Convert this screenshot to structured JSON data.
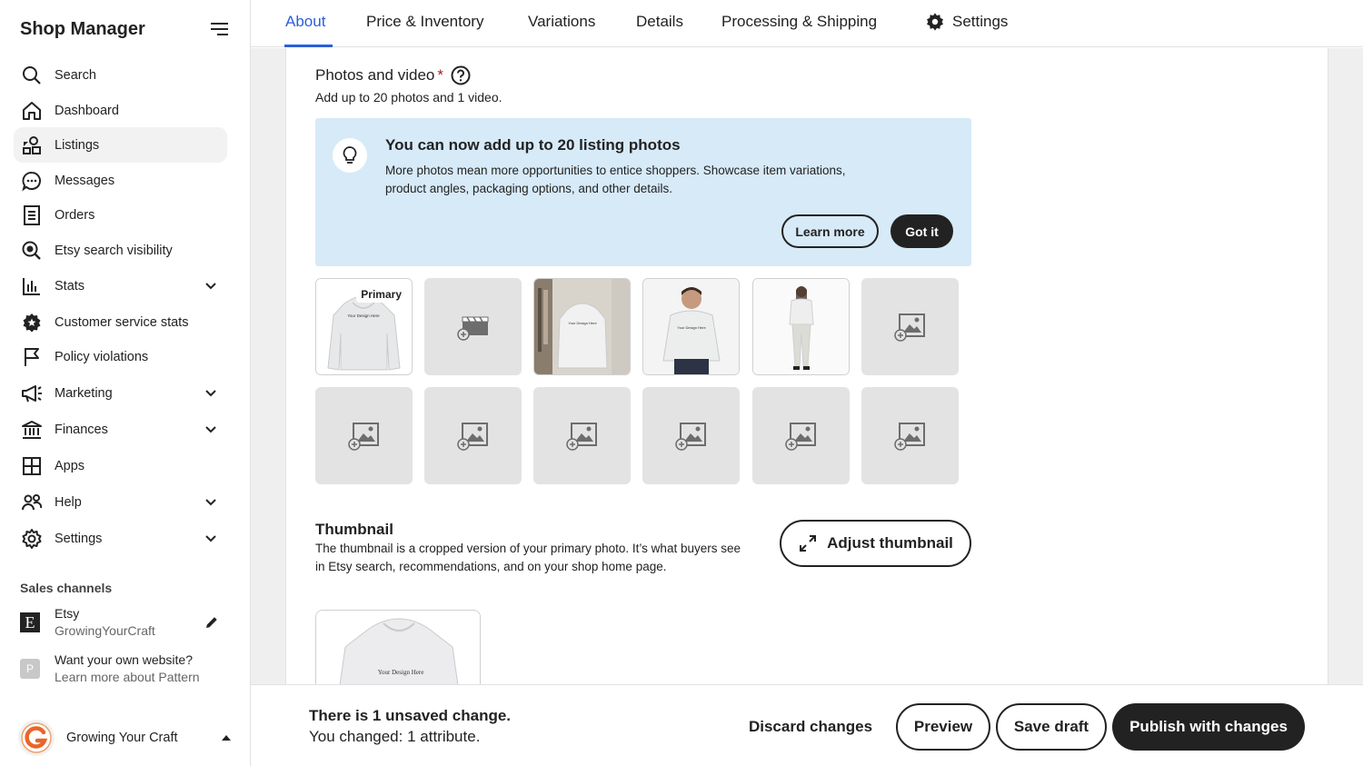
{
  "sidebar": {
    "title": "Shop Manager",
    "items": [
      {
        "label": "Search",
        "icon": "search-icon"
      },
      {
        "label": "Dashboard",
        "icon": "home-icon"
      },
      {
        "label": "Listings",
        "icon": "listings-icon",
        "active": true
      },
      {
        "label": "Messages",
        "icon": "messages-icon"
      },
      {
        "label": "Orders",
        "icon": "orders-icon"
      },
      {
        "label": "Etsy search visibility",
        "icon": "search-visibility-icon"
      },
      {
        "label": "Stats",
        "icon": "stats-icon",
        "expandable": true
      },
      {
        "label": "Customer service stats",
        "icon": "badge-icon"
      },
      {
        "label": "Policy violations",
        "icon": "flag-icon"
      },
      {
        "label": "Marketing",
        "icon": "megaphone-icon",
        "expandable": true
      },
      {
        "label": "Finances",
        "icon": "bank-icon",
        "expandable": true
      },
      {
        "label": "Apps",
        "icon": "apps-icon"
      },
      {
        "label": "Help",
        "icon": "people-icon",
        "expandable": true
      },
      {
        "label": "Settings",
        "icon": "gear-icon",
        "expandable": true
      }
    ],
    "sales_channels_title": "Sales channels",
    "channel": {
      "badge": "E",
      "name": "Etsy",
      "shop": "GrowingYourCraft"
    },
    "pattern": {
      "badge": "P",
      "title": "Want your own website?",
      "sub": "Learn more about Pattern"
    },
    "shop_user": {
      "name": "Growing Your Craft"
    }
  },
  "tabs": [
    {
      "label": "About",
      "active": true
    },
    {
      "label": "Price & Inventory"
    },
    {
      "label": "Variations"
    },
    {
      "label": "Details"
    },
    {
      "label": "Processing & Shipping"
    },
    {
      "label": "Settings",
      "icon": "gear-icon"
    }
  ],
  "photos": {
    "title": "Photos and video",
    "required_mark": "*",
    "subtitle": "Add up to 20 photos and 1 video.",
    "primary_tag": "Primary",
    "design_text": "Your Design Here"
  },
  "banner": {
    "title": "You can now add up to 20 listing photos",
    "text": "More photos mean more opportunities to entice shoppers. Showcase item variations, product angles, packaging options, and other details.",
    "learn_more": "Learn more",
    "got_it": "Got it",
    "bg_color": "#d7eaf8"
  },
  "thumbnail": {
    "title": "Thumbnail",
    "text": "The thumbnail is a cropped version of your primary photo. It’s what buyers see in Etsy search, recommendations, and on your shop home page.",
    "adjust_label": "Adjust thumbnail"
  },
  "footer": {
    "title": "There is 1 unsaved change.",
    "sub": "You changed: 1 attribute.",
    "discard": "Discard changes",
    "preview": "Preview",
    "save_draft": "Save draft",
    "publish": "Publish with changes"
  },
  "colors": {
    "accent": "#2b5fd9",
    "dark": "#222222",
    "required": "#a61a2e"
  }
}
